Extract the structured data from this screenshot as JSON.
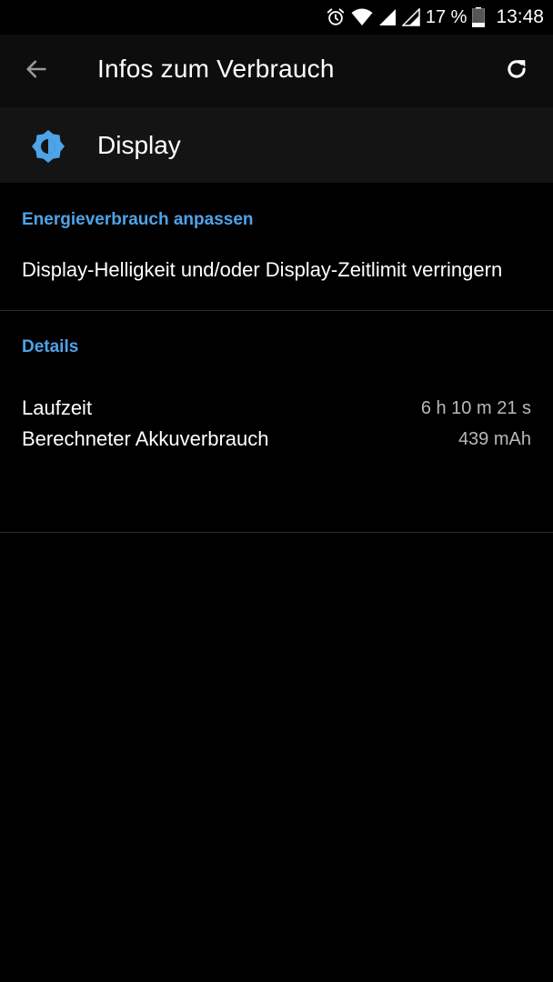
{
  "status_bar": {
    "battery_percent": "17 %",
    "time": "13:48",
    "icons": [
      "alarm-icon",
      "wifi-icon",
      "signal-icon",
      "signal-icon",
      "battery-icon"
    ]
  },
  "app_bar": {
    "title": "Infos zum Verbrauch",
    "back_icon": "arrow-back-icon",
    "refresh_icon": "refresh-icon"
  },
  "app_header": {
    "icon": "brightness-icon",
    "name": "Display"
  },
  "sections": {
    "energy": {
      "header": "Energieverbrauch anpassen",
      "suggestion": "Display-Helligkeit und/oder Display-Zeitlimit verringern"
    },
    "details": {
      "header": "Details",
      "rows": [
        {
          "label": "Laufzeit",
          "value": "6 h 10 m 21 s"
        },
        {
          "label": "Berechneter Akkuverbrauch",
          "value": "439 mAh"
        }
      ]
    }
  },
  "colors": {
    "accent": "#4fa3e8",
    "background": "#000000",
    "app_bar_bg": "#0d0d0d",
    "header_bg": "#141414"
  }
}
